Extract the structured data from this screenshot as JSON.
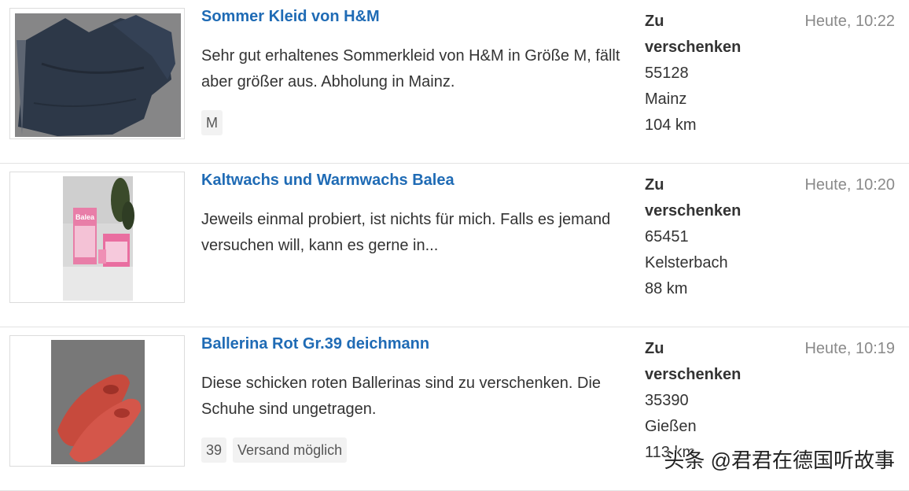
{
  "listings": [
    {
      "title": "Sommer Kleid von H&M",
      "description": "Sehr gut erhaltenes Sommerkleid von H&M in Größe M, fällt aber größer aus. Abholung in Mainz.",
      "tags": [
        "M"
      ],
      "price": "Zu verschenken",
      "zip": "55128",
      "city": "Mainz",
      "distance": "104 km",
      "date": "Heute, 10:22"
    },
    {
      "title": "Kaltwachs und Warmwachs Balea",
      "description": "Jeweils einmal probiert, ist nichts für mich. Falls es jemand versuchen will, kann es gerne in...",
      "tags": [],
      "price": "Zu verschenken",
      "zip": "65451",
      "city": "Kelsterbach",
      "distance": "88 km",
      "date": "Heute, 10:20",
      "image_text": "Balea"
    },
    {
      "title": "Ballerina Rot Gr.39 deichmann",
      "description": "Diese schicken roten Ballerinas sind zu verschenken. Die Schuhe sind ungetragen.",
      "tags": [
        "39",
        "Versand möglich"
      ],
      "price": "Zu verschenken",
      "zip": "35390",
      "city": "Gießen",
      "distance": "113 km",
      "date": "Heute, 10:19"
    }
  ],
  "watermark": "头条 @君君在德国听故事",
  "colors": {
    "title": "#1f6bb5",
    "date": "#8a8a8a",
    "tag_bg": "#f2f2f2",
    "border": "#e3e3e3"
  }
}
